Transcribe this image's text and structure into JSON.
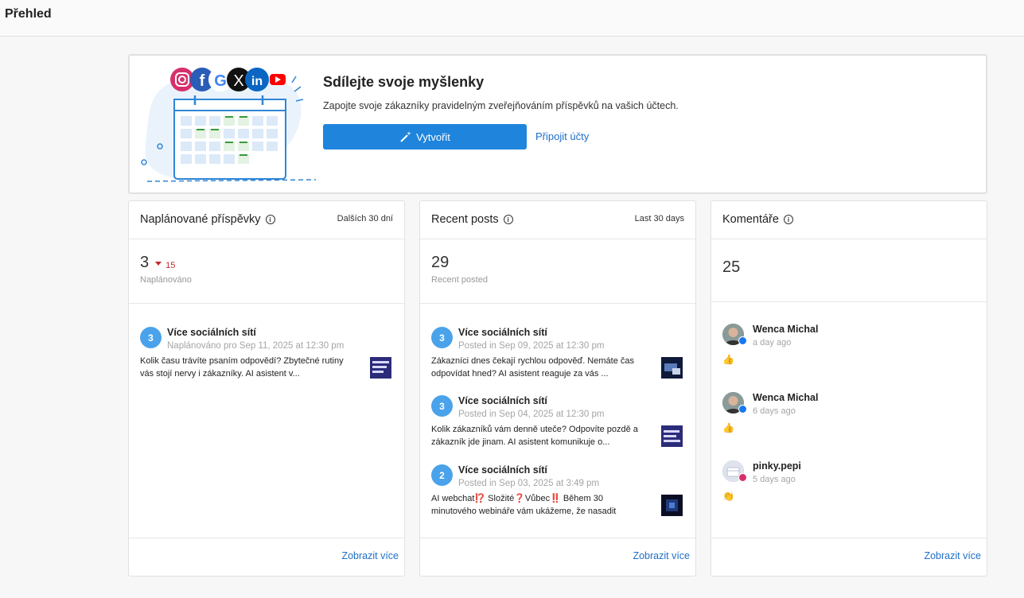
{
  "page": {
    "title": "Přehled"
  },
  "hero": {
    "title": "Sdílejte svoje myšlenky",
    "subtitle": "Zapojte svoje zákazníky pravidelným zveřejňováním příspěvků na vašich účtech.",
    "create_button": "Vytvořit",
    "connect_link": "Připojit účty",
    "accent_color": "#1f84dc"
  },
  "scheduled": {
    "title": "Naplánované příspěvky",
    "range": "Dalších 30 dní",
    "count": "3",
    "delta": "15",
    "stat_label": "Naplánováno",
    "posts": [
      {
        "badge": "3",
        "title": "Více sociálních sítí",
        "meta": "Naplánováno pro Sep 11, 2025 at 12:30 pm",
        "text": "Kolik času trávíte psaním odpovědí? Zbytečné rutiny vás stojí nervy i zákazníky. AI asistent v..."
      }
    ],
    "more": "Zobrazit více"
  },
  "recent": {
    "title": "Recent posts",
    "range": "Last 30 days",
    "count": "29",
    "stat_label": "Recent posted",
    "posts": [
      {
        "badge": "3",
        "title": "Více sociálních sítí",
        "meta": "Posted in Sep 09, 2025 at 12:30 pm",
        "text": "Zákazníci dnes čekají rychlou odpověď. Nemáte čas odpovídat hned? AI asistent reaguje za vás ..."
      },
      {
        "badge": "3",
        "title": "Více sociálních sítí",
        "meta": "Posted in Sep 04, 2025 at 12:30 pm",
        "text": "Kolik zákazníků vám denně uteče? Odpovíte pozdě a zákazník jde jinam. AI asistent komunikuje o..."
      },
      {
        "badge": "2",
        "title": "Více sociálních sítí",
        "meta": "Posted in Sep 03, 2025 at 3:49 pm",
        "text": "AI webchat⁉️ Složité❓Vůbec‼️ Během 30 minutového webináře vám ukážeme, že nasadit"
      }
    ],
    "more": "Zobrazit více"
  },
  "comments": {
    "title": "Komentáře",
    "count": "25",
    "items": [
      {
        "name": "Wenca Michal",
        "time": "a day ago",
        "emoji": "👍",
        "network": "facebook"
      },
      {
        "name": "Wenca Michal",
        "time": "6 days ago",
        "emoji": "👍",
        "network": "facebook"
      },
      {
        "name": "pinky.pepi",
        "time": "5 days ago",
        "emoji": "👏",
        "network": "instagram"
      }
    ],
    "more": "Zobrazit více"
  }
}
